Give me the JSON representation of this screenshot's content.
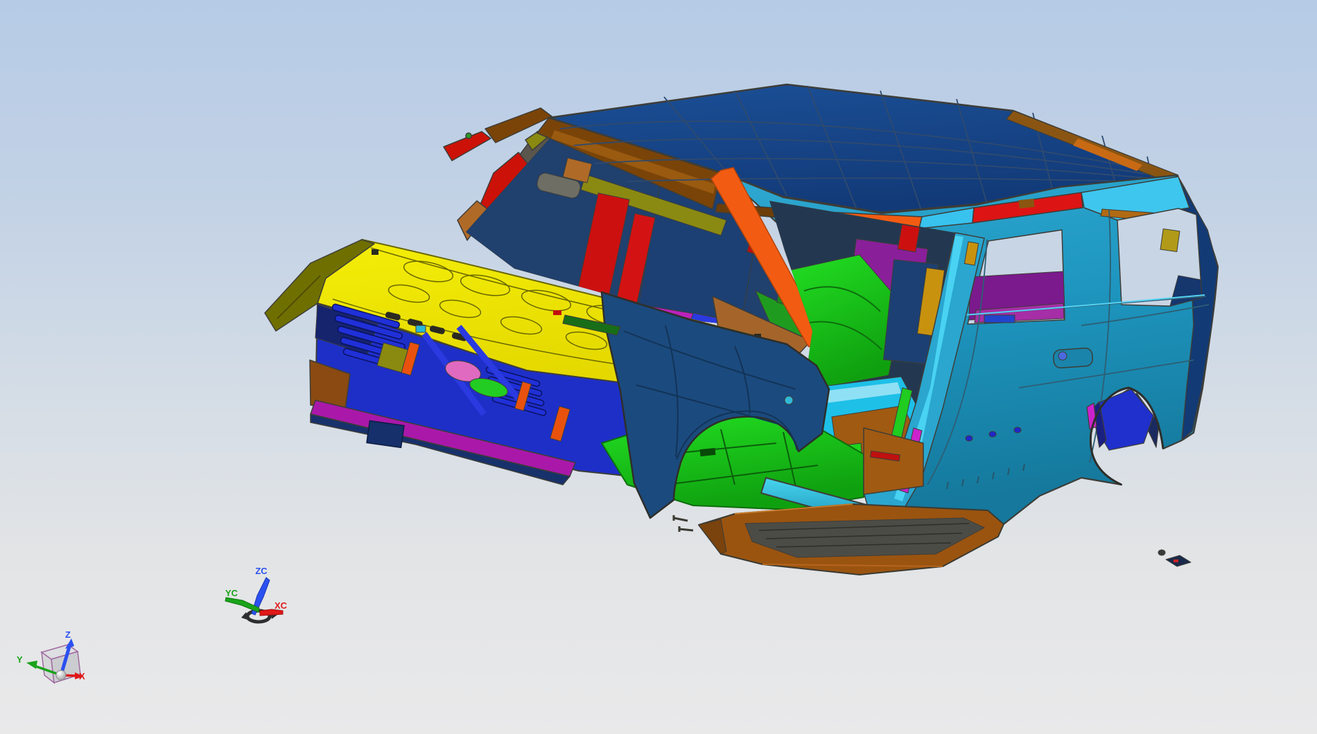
{
  "viewport": {
    "type": "cad-3d-viewport",
    "background_top": "#b6cbe6",
    "background_bottom": "#e9e9ea"
  },
  "triads": {
    "wcs": {
      "z": "ZC",
      "y": "YC",
      "x": "XC",
      "axis_colors": {
        "z": "#2a50f0",
        "y": "#1aa31a",
        "x": "#e01818"
      }
    },
    "world": {
      "z": "Z",
      "y": "Y",
      "x": "X",
      "axis_colors": {
        "z": "#2a50f0",
        "y": "#1aa31a",
        "x": "#e01818"
      }
    }
  },
  "model": {
    "name": "SUV body-in-white assembly",
    "parts": [
      {
        "name": "roof-panel",
        "color": "#18498c"
      },
      {
        "name": "hood-panel",
        "color": "#f0e904"
      },
      {
        "name": "body-side-quarter",
        "color": "#1e96bf"
      },
      {
        "name": "roof-side-rail",
        "color": "#38c2ee"
      },
      {
        "name": "a-pillar",
        "color": "#f25c12"
      },
      {
        "name": "windshield-header-trim",
        "color": "#7a4408"
      },
      {
        "name": "front-fender",
        "color": "#1b4a7e"
      },
      {
        "name": "radiator-support",
        "color": "#1e2fc8"
      },
      {
        "name": "bumper-crossmember",
        "color": "#aa18aa"
      },
      {
        "name": "floor-pan-front",
        "color": "#17d017"
      },
      {
        "name": "floor-pan-rear",
        "color": "#a05a12"
      },
      {
        "name": "running-board",
        "color": "#9a5410"
      },
      {
        "name": "quarter-inner-trim",
        "color": "#7a1a8c"
      },
      {
        "name": "b-pillar-inner",
        "color": "#c8920f"
      },
      {
        "name": "rear-wheelhouse",
        "color": "#2030cc"
      },
      {
        "name": "seat-frame",
        "color": "#1fb51f"
      },
      {
        "name": "cowl-panel",
        "color": "#bb22bb"
      },
      {
        "name": "header-inner",
        "color": "#8a8a12"
      },
      {
        "name": "a-pillar-inner",
        "color": "#cc1208"
      },
      {
        "name": "interior-panel",
        "color": "#1c4073"
      }
    ]
  }
}
